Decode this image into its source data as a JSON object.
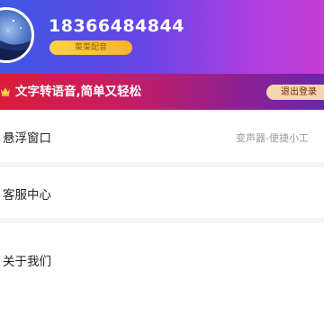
{
  "profile": {
    "phone": "18366484844",
    "badge": "菜菜配音"
  },
  "promo": {
    "text": "文字转语音,简单又轻松",
    "logout_label": "退出登录",
    "crown_icon": "crown-icon"
  },
  "menu": {
    "items": [
      {
        "label": "悬浮窗口",
        "value": "变声器-便捷小工"
      },
      {
        "label": "客服中心"
      },
      {
        "label": "关于我们"
      }
    ]
  },
  "colors": {
    "header_start": "#3d57e6",
    "header_end": "#c43ed6",
    "banner_start": "#d81e3c",
    "banner_end": "#6a28a8",
    "badge": "#f5b42a",
    "pill": "#f6d6b0"
  }
}
